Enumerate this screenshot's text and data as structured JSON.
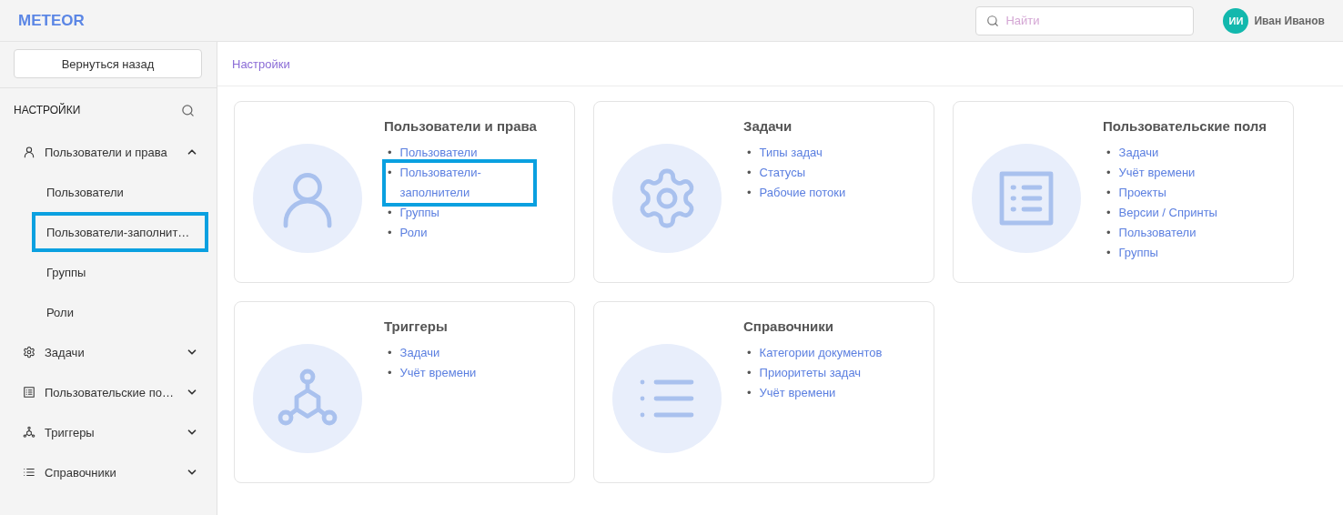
{
  "header": {
    "logo": "METEOR",
    "search": {
      "placeholder": "Найти"
    },
    "user": {
      "initials": "ИИ",
      "name": "Иван Иванов"
    }
  },
  "sidebar": {
    "back_button": "Вернуться назад",
    "title": "НАСТРОЙКИ",
    "items": [
      {
        "label": "Пользователи и права",
        "kind": "user",
        "expanded": true,
        "children": [
          {
            "label": "Пользователи",
            "highlighted": false
          },
          {
            "label": "Пользователи-заполнит…",
            "highlighted": true
          },
          {
            "label": "Группы",
            "highlighted": false
          },
          {
            "label": "Роли",
            "highlighted": false
          }
        ]
      },
      {
        "label": "Задачи",
        "kind": "gear",
        "expanded": false
      },
      {
        "label": "Пользовательские по…",
        "kind": "form",
        "expanded": false
      },
      {
        "label": "Триггеры",
        "kind": "trigger",
        "expanded": false
      },
      {
        "label": "Справочники",
        "kind": "list",
        "expanded": false
      }
    ]
  },
  "breadcrumb": "Настройки",
  "cards": [
    {
      "title": "Пользователи и права",
      "kind": "user",
      "links": [
        {
          "marker": "•",
          "label": "Пользователи",
          "highlighted": false
        },
        {
          "marker": "•",
          "label": "Пользователи-заполнители",
          "highlighted": true
        },
        {
          "marker": "•",
          "label": "Группы",
          "highlighted": false
        },
        {
          "marker": "•",
          "label": "Роли",
          "highlighted": false
        }
      ]
    },
    {
      "title": "Задачи",
      "kind": "gear",
      "links": [
        {
          "marker": "•",
          "label": "Типы задач",
          "highlighted": false
        },
        {
          "marker": "•",
          "label": "Статусы",
          "highlighted": false
        },
        {
          "marker": "•",
          "label": "Рабочие потоки",
          "highlighted": false
        }
      ]
    },
    {
      "title": "Пользовательские поля",
      "kind": "form",
      "links": [
        {
          "marker": "•",
          "label": "Задачи",
          "highlighted": false
        },
        {
          "marker": "•",
          "label": "Учёт времени",
          "highlighted": false
        },
        {
          "marker": "•",
          "label": "Проекты",
          "highlighted": false
        },
        {
          "marker": "•",
          "label": "Версии / Спринты",
          "highlighted": false
        },
        {
          "marker": "•",
          "label": "Пользователи",
          "highlighted": false
        },
        {
          "marker": "•",
          "label": "Группы",
          "highlighted": false
        }
      ]
    },
    {
      "title": "Триггеры",
      "kind": "trigger",
      "links": [
        {
          "marker": "•",
          "label": "Задачи",
          "highlighted": false
        },
        {
          "marker": "•",
          "label": "Учёт времени",
          "highlighted": false
        }
      ]
    },
    {
      "title": "Справочники",
      "kind": "list",
      "links": [
        {
          "marker": "•",
          "label": "Категории документов",
          "highlighted": false
        },
        {
          "marker": "•",
          "label": "Приоритеты задач",
          "highlighted": false
        },
        {
          "marker": "•",
          "label": "Учёт времени",
          "highlighted": false
        }
      ]
    }
  ]
}
